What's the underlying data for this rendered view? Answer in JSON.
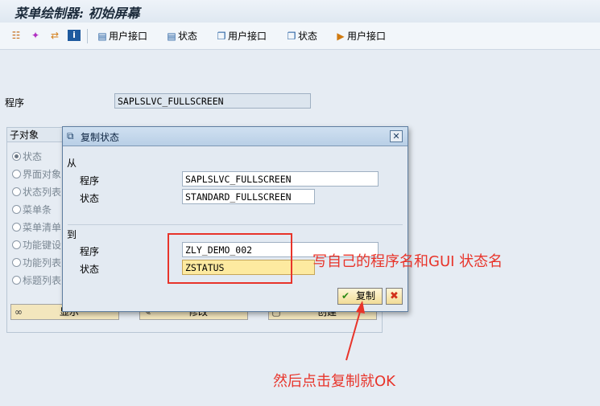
{
  "window": {
    "title": "菜单绘制器: 初始屏幕"
  },
  "toolbar": {
    "icons": [
      "hierarchy-icon",
      "magic-wand-icon",
      "transfer-icon",
      "info-icon"
    ],
    "buttons": [
      {
        "icon": "trash-icon",
        "label": "用户接口"
      },
      {
        "icon": "trash-icon",
        "label": "状态"
      },
      {
        "icon": "copy-icon",
        "label": "用户接口"
      },
      {
        "icon": "copy-icon",
        "label": "状态"
      },
      {
        "icon": "rename-icon",
        "label": "用户接口"
      }
    ]
  },
  "main": {
    "program_label": "程序",
    "program_value": "SAPLSLVC_FULLSCREEN",
    "subobjects": {
      "title": "子对象",
      "options": [
        "状态",
        "界面对象",
        "状态列表",
        "菜单条",
        "菜单清单",
        "功能键设",
        "功能列表",
        "标题列表"
      ],
      "selected": "状态"
    },
    "actions": [
      {
        "label": "显示"
      },
      {
        "label": "修改"
      },
      {
        "label": "创建"
      }
    ]
  },
  "dialog": {
    "title": "复制状态",
    "from_label": "从",
    "to_label": "到",
    "program_label": "程序",
    "status_label": "状态",
    "from_program": "SAPLSLVC_FULLSCREEN",
    "from_status": "STANDARD_FULLSCREEN",
    "to_program": "ZLY_DEMO_002",
    "to_status": "ZSTATUS",
    "copy_label": "复制"
  },
  "annotations": {
    "note1": "写自己的程序名和GUI 状态名",
    "note2": "然后点击复制就OK",
    "color": "#e8342a"
  }
}
